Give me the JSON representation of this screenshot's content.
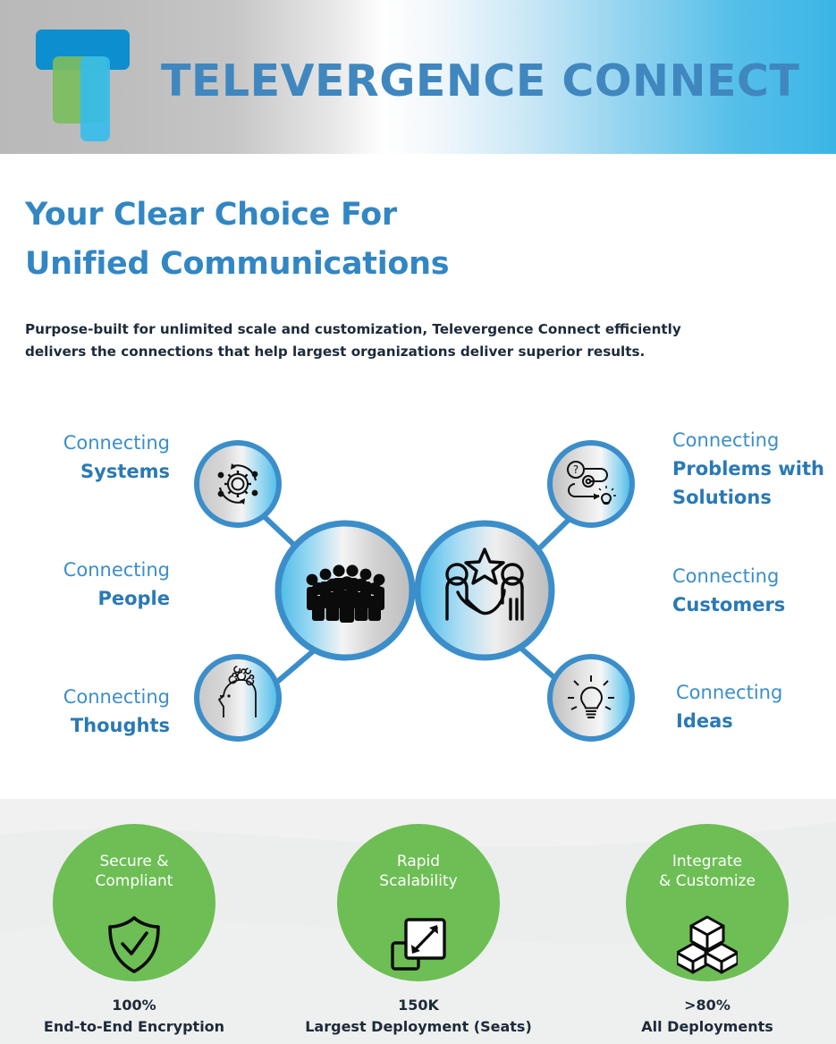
{
  "header": {
    "brand_title": "TELEVERGENCE CONNECT",
    "brand_color": "#3f87be",
    "logo_colors": {
      "bar": "#0d8ecf",
      "green": "#79bd5f",
      "cyan": "#35bdec"
    }
  },
  "hero": {
    "headline_line1": "Your Clear Choice For",
    "headline_line2": "Unified Communications",
    "headline_color": "#3286c4",
    "paragraph": "Purpose-built for unlimited scale and customization, Televergence Connect efficiently delivers the connections that help largest organizations deliver superior results."
  },
  "diagram": {
    "accent_color": "#3b8ec9",
    "nodes": [
      {
        "id": "systems",
        "prefix": "Connecting",
        "emphasis": "Systems",
        "icon": "gear-cycle-icon",
        "side": "left",
        "size": "small"
      },
      {
        "id": "people",
        "prefix": "Connecting",
        "emphasis": "People",
        "icon": "crowd-people-icon",
        "side": "left",
        "size": "large"
      },
      {
        "id": "thoughts",
        "prefix": "Connecting",
        "emphasis": "Thoughts",
        "icon": "head-thoughts-icon",
        "side": "left",
        "size": "small"
      },
      {
        "id": "problems",
        "prefix": "Connecting",
        "emphasis": "Problems with Solutions",
        "icon": "problem-solution-icon",
        "side": "right",
        "size": "small"
      },
      {
        "id": "customers",
        "prefix": "Connecting",
        "emphasis": "Customers",
        "icon": "handshake-star-icon",
        "side": "right",
        "size": "large"
      },
      {
        "id": "ideas",
        "prefix": "Connecting",
        "emphasis": "Ideas",
        "icon": "lightbulb-icon",
        "side": "right",
        "size": "small"
      }
    ]
  },
  "stats": {
    "background": "#eceeed",
    "oval_color": "#6dbe54",
    "items": [
      {
        "caption_line1": "Secure &",
        "caption_line2": "Compliant",
        "icon": "shield-check-icon",
        "value": "100%",
        "label": "End-to-End Encryption"
      },
      {
        "caption_line1": "Rapid",
        "caption_line2": "Scalability",
        "icon": "resize-arrow-icon",
        "value": "150K",
        "label": "Largest Deployment (Seats)"
      },
      {
        "caption_line1": "Integrate",
        "caption_line2": "& Customize",
        "icon": "cubes-stack-icon",
        "value": ">80%",
        "label": "All Deployments"
      }
    ]
  }
}
